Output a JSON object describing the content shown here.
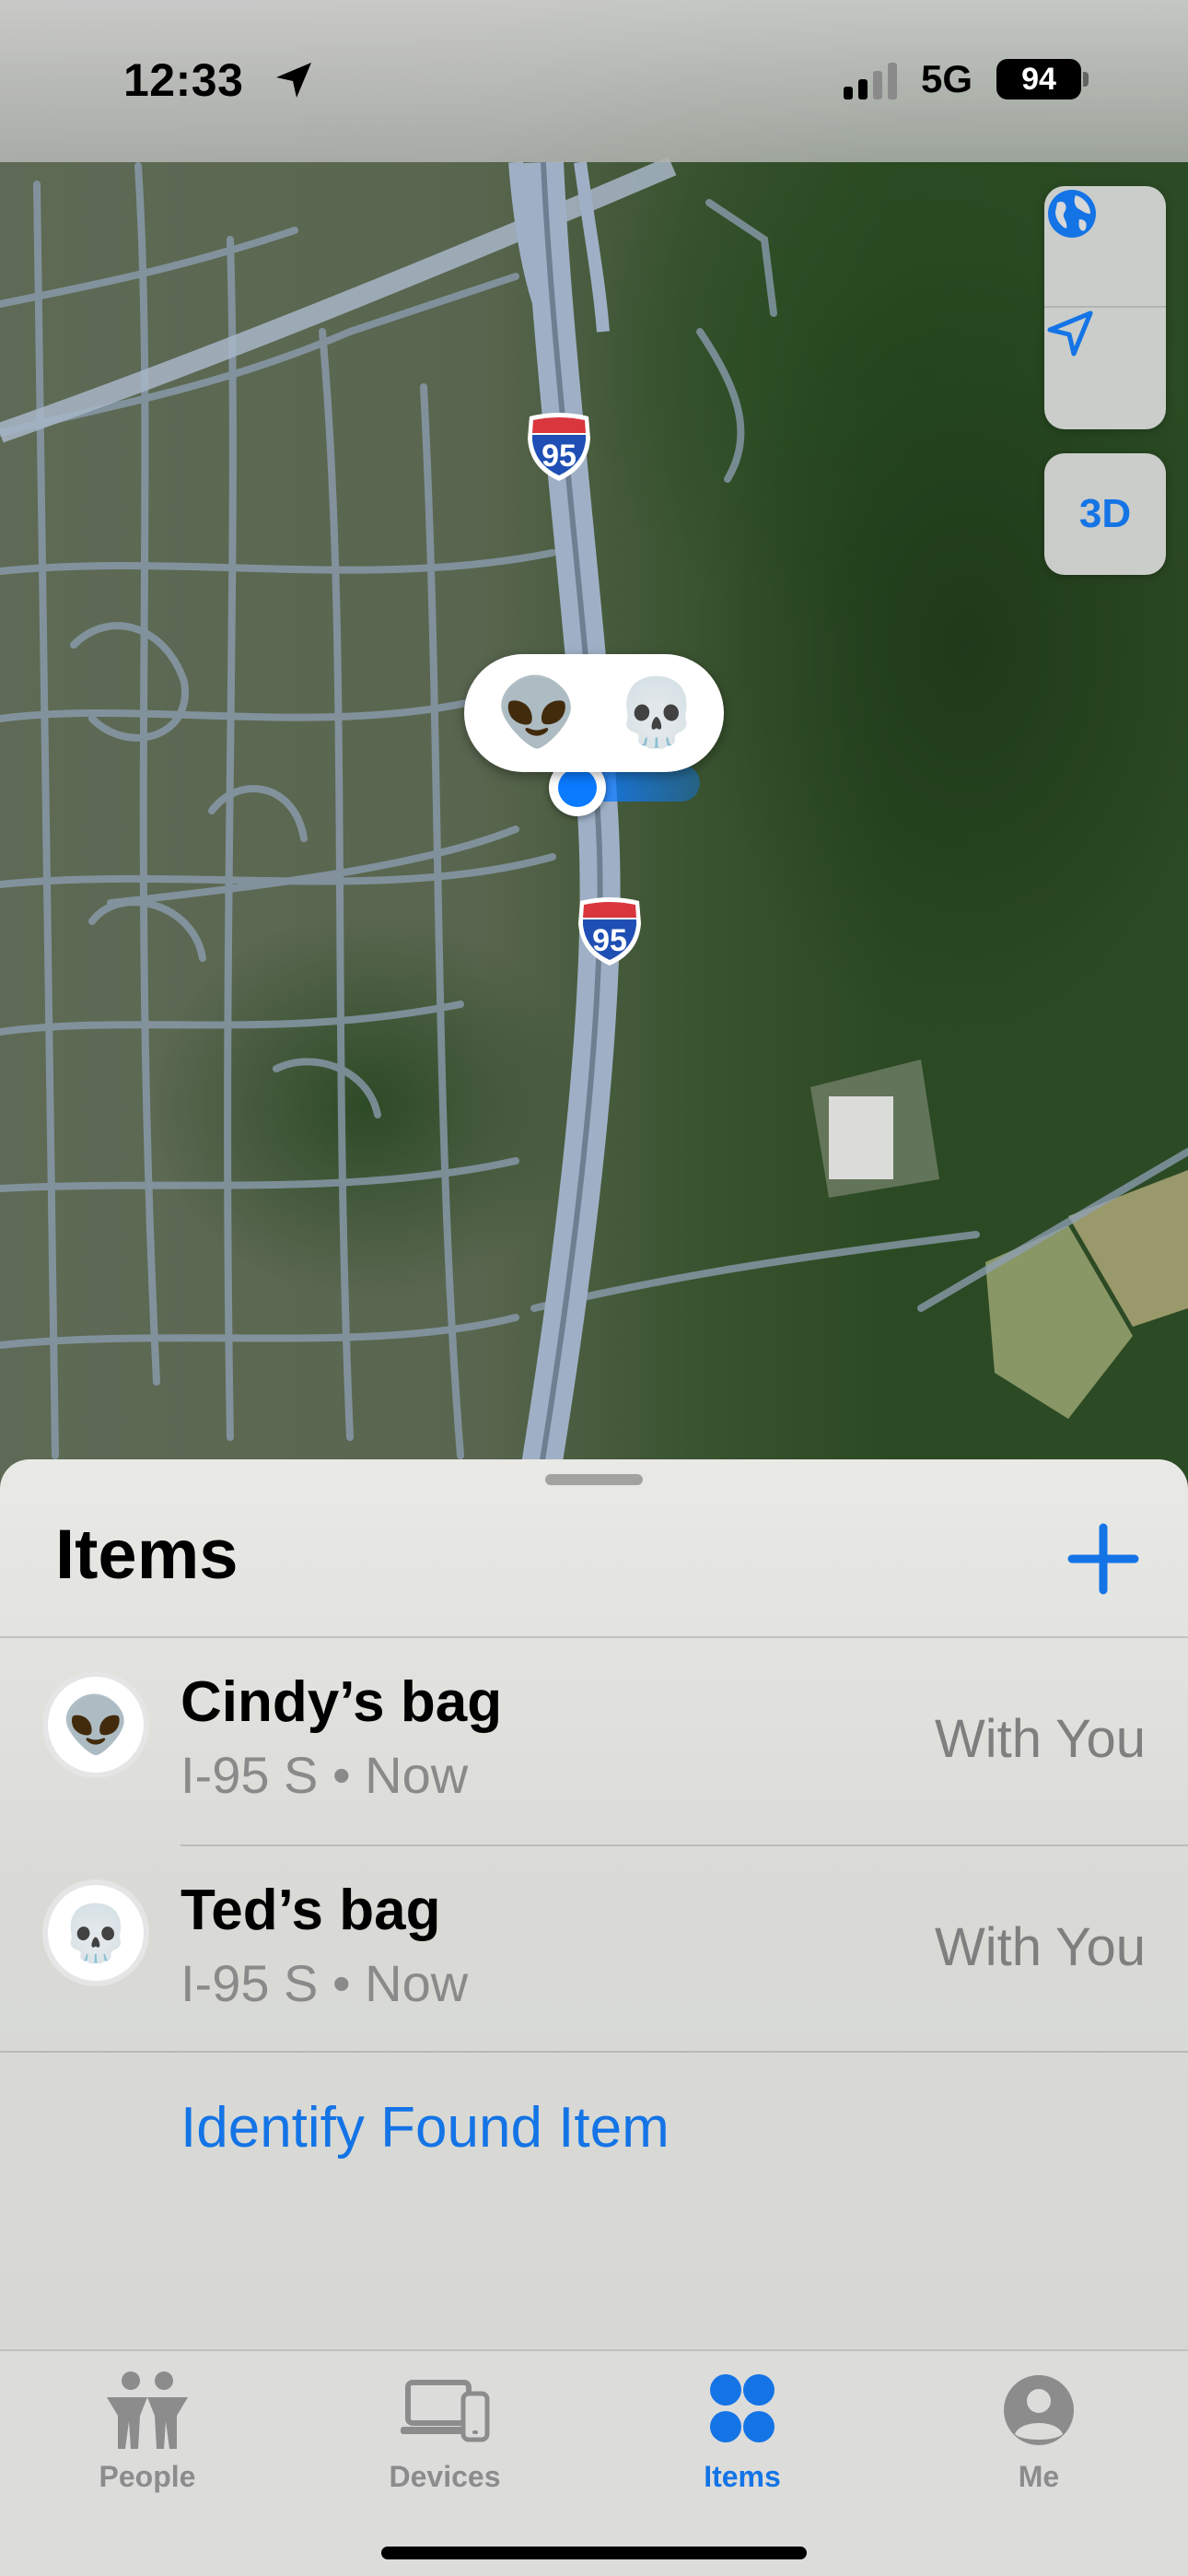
{
  "status_bar": {
    "time": "12:33",
    "network": "5G",
    "battery": "94"
  },
  "map": {
    "highway_shield": "95",
    "controls": [
      "globe-icon",
      "location-arrow-icon"
    ],
    "three_d_label": "3D",
    "callout_emojis": [
      "👽",
      "💀"
    ]
  },
  "sheet": {
    "title": "Items",
    "items": [
      {
        "emoji": "👽",
        "name": "Cindy’s bag",
        "subtitle": "I-95 S • Now",
        "status": "With You"
      },
      {
        "emoji": "💀",
        "name": "Ted’s bag",
        "subtitle": "I-95 S • Now",
        "status": "With You"
      }
    ],
    "identify_label": "Identify Found Item"
  },
  "tabbar": {
    "tabs": [
      {
        "label": "People",
        "icon": "people-icon"
      },
      {
        "label": "Devices",
        "icon": "devices-icon"
      },
      {
        "label": "Items",
        "icon": "items-icon",
        "active": true
      },
      {
        "label": "Me",
        "icon": "me-icon"
      }
    ]
  },
  "colors": {
    "accent": "#1474e6",
    "secondary_text": "#8a8a8a",
    "user_dot": "#0a7aff"
  }
}
